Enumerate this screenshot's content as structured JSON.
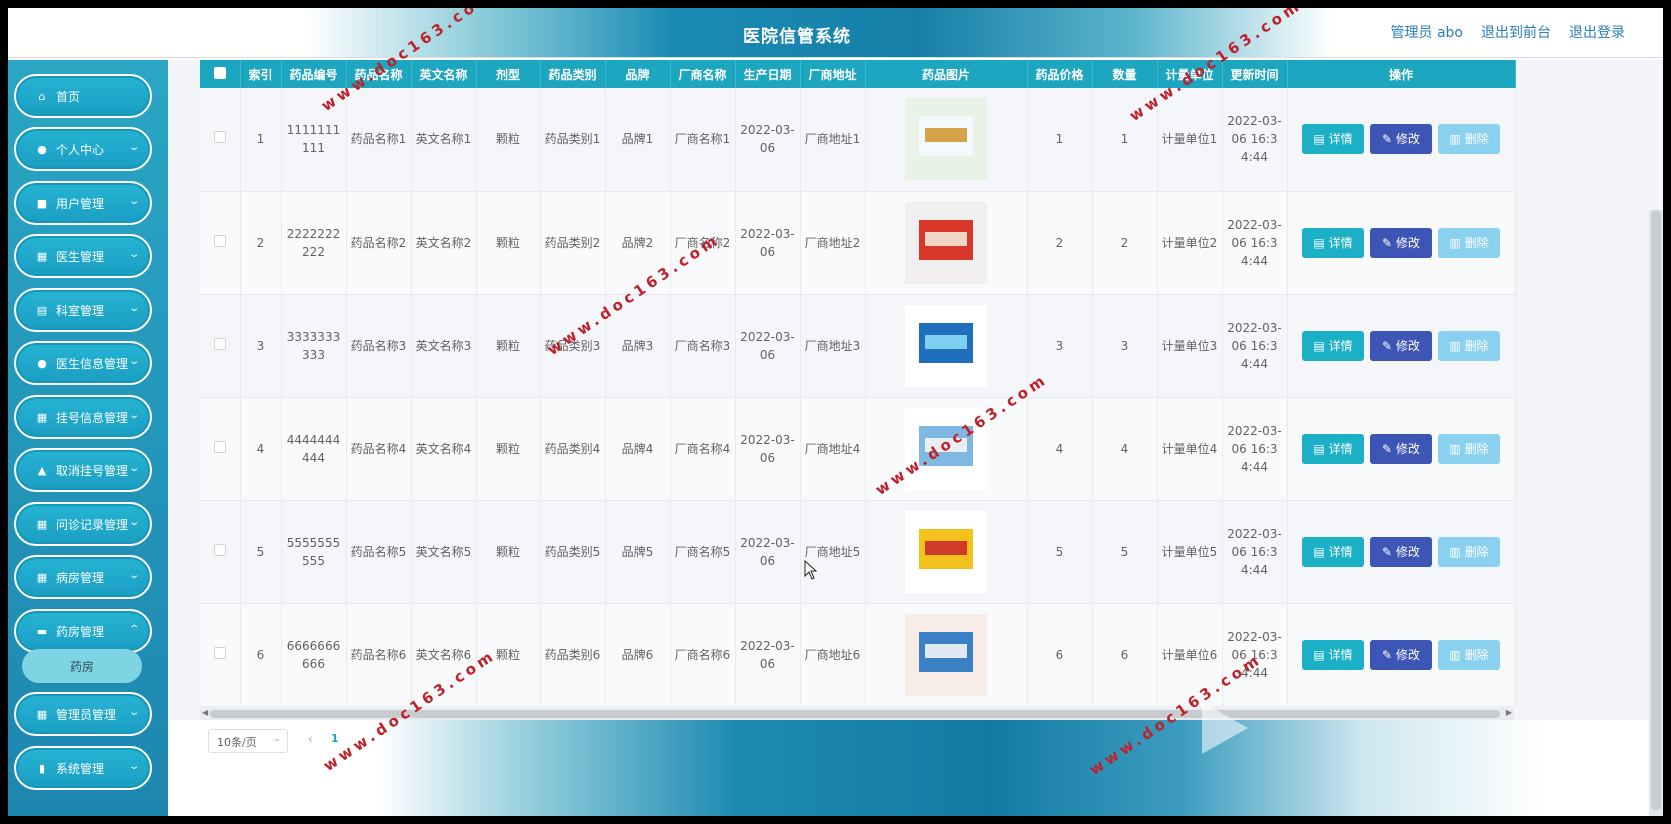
{
  "header": {
    "title": "医院信管系统",
    "admin_label": "管理员 abo",
    "to_front_label": "退出到前台",
    "logout_label": "退出登录"
  },
  "sidebar": {
    "items": [
      {
        "label": "首页",
        "icon": "home-icon"
      },
      {
        "label": "个人中心",
        "icon": "user-icon"
      },
      {
        "label": "用户管理",
        "icon": "briefcase-icon"
      },
      {
        "label": "医生管理",
        "icon": "grid-icon"
      },
      {
        "label": "科室管理",
        "icon": "clipboard-icon"
      },
      {
        "label": "医生信息管理",
        "icon": "user-icon"
      },
      {
        "label": "挂号信息管理",
        "icon": "grid-icon"
      },
      {
        "label": "取消挂号管理",
        "icon": "house-icon"
      },
      {
        "label": "问诊记录管理",
        "icon": "grid-icon"
      },
      {
        "label": "病房管理",
        "icon": "grid-icon"
      },
      {
        "label": "药房管理",
        "icon": "ticket-icon"
      },
      {
        "label": "管理员管理",
        "icon": "grid-icon"
      },
      {
        "label": "系统管理",
        "icon": "book-icon"
      }
    ],
    "sub_item": "药房"
  },
  "table": {
    "headers": [
      "索引",
      "药品编号",
      "药品名称",
      "英文名称",
      "剂型",
      "药品类别",
      "品牌",
      "厂商名称",
      "生产日期",
      "厂商地址",
      "药品图片",
      "药品价格",
      "数量",
      "计量单位",
      "更新时间",
      "操作"
    ],
    "rows": [
      {
        "index": "1",
        "code": "1111111111",
        "name": "药品名称1",
        "en_name": "英文名称1",
        "form": "颗粒",
        "category": "药品类别1",
        "brand": "品牌1",
        "maker": "厂商名称1",
        "date": "2022-03-06",
        "address": "厂商地址1",
        "price": "1",
        "qty": "1",
        "unit": "计量单位1",
        "updated": "2022-03-06 16:34:44"
      },
      {
        "index": "2",
        "code": "2222222222",
        "name": "药品名称2",
        "en_name": "英文名称2",
        "form": "颗粒",
        "category": "药品类别2",
        "brand": "品牌2",
        "maker": "厂商名称2",
        "date": "2022-03-06",
        "address": "厂商地址2",
        "price": "2",
        "qty": "2",
        "unit": "计量单位2",
        "updated": "2022-03-06 16:34:44"
      },
      {
        "index": "3",
        "code": "3333333333",
        "name": "药品名称3",
        "en_name": "英文名称3",
        "form": "颗粒",
        "category": "药品类别3",
        "brand": "品牌3",
        "maker": "厂商名称3",
        "date": "2022-03-06",
        "address": "厂商地址3",
        "price": "3",
        "qty": "3",
        "unit": "计量单位3",
        "updated": "2022-03-06 16:34:44"
      },
      {
        "index": "4",
        "code": "4444444444",
        "name": "药品名称4",
        "en_name": "英文名称4",
        "form": "颗粒",
        "category": "药品类别4",
        "brand": "品牌4",
        "maker": "厂商名称4",
        "date": "2022-03-06",
        "address": "厂商地址4",
        "price": "4",
        "qty": "4",
        "unit": "计量单位4",
        "updated": "2022-03-06 16:34:44"
      },
      {
        "index": "5",
        "code": "5555555555",
        "name": "药品名称5",
        "en_name": "英文名称5",
        "form": "颗粒",
        "category": "药品类别5",
        "brand": "品牌5",
        "maker": "厂商名称5",
        "date": "2022-03-06",
        "address": "厂商地址5",
        "price": "5",
        "qty": "5",
        "unit": "计量单位5",
        "updated": "2022-03-06 16:34:44"
      },
      {
        "index": "6",
        "code": "6666666666",
        "name": "药品名称6",
        "en_name": "英文名称6",
        "form": "颗粒",
        "category": "药品类别6",
        "brand": "品牌6",
        "maker": "厂商名称6",
        "date": "2022-03-06",
        "address": "厂商地址6",
        "price": "6",
        "qty": "6",
        "unit": "计量单位6",
        "updated": "2022-03-06 16:34:44"
      }
    ],
    "actions": {
      "detail": "详情",
      "edit": "修改",
      "delete": "删除"
    }
  },
  "pager": {
    "page_size": "10条/页",
    "current_page": "1"
  },
  "watermark": "www.doc163.com",
  "colors": {
    "accent": "#1ca6bf",
    "edit_button": "#3d55b5",
    "delete_button": "#8ad0ef",
    "sidebar": "#1d9fc3",
    "watermark": "#c0202a"
  }
}
